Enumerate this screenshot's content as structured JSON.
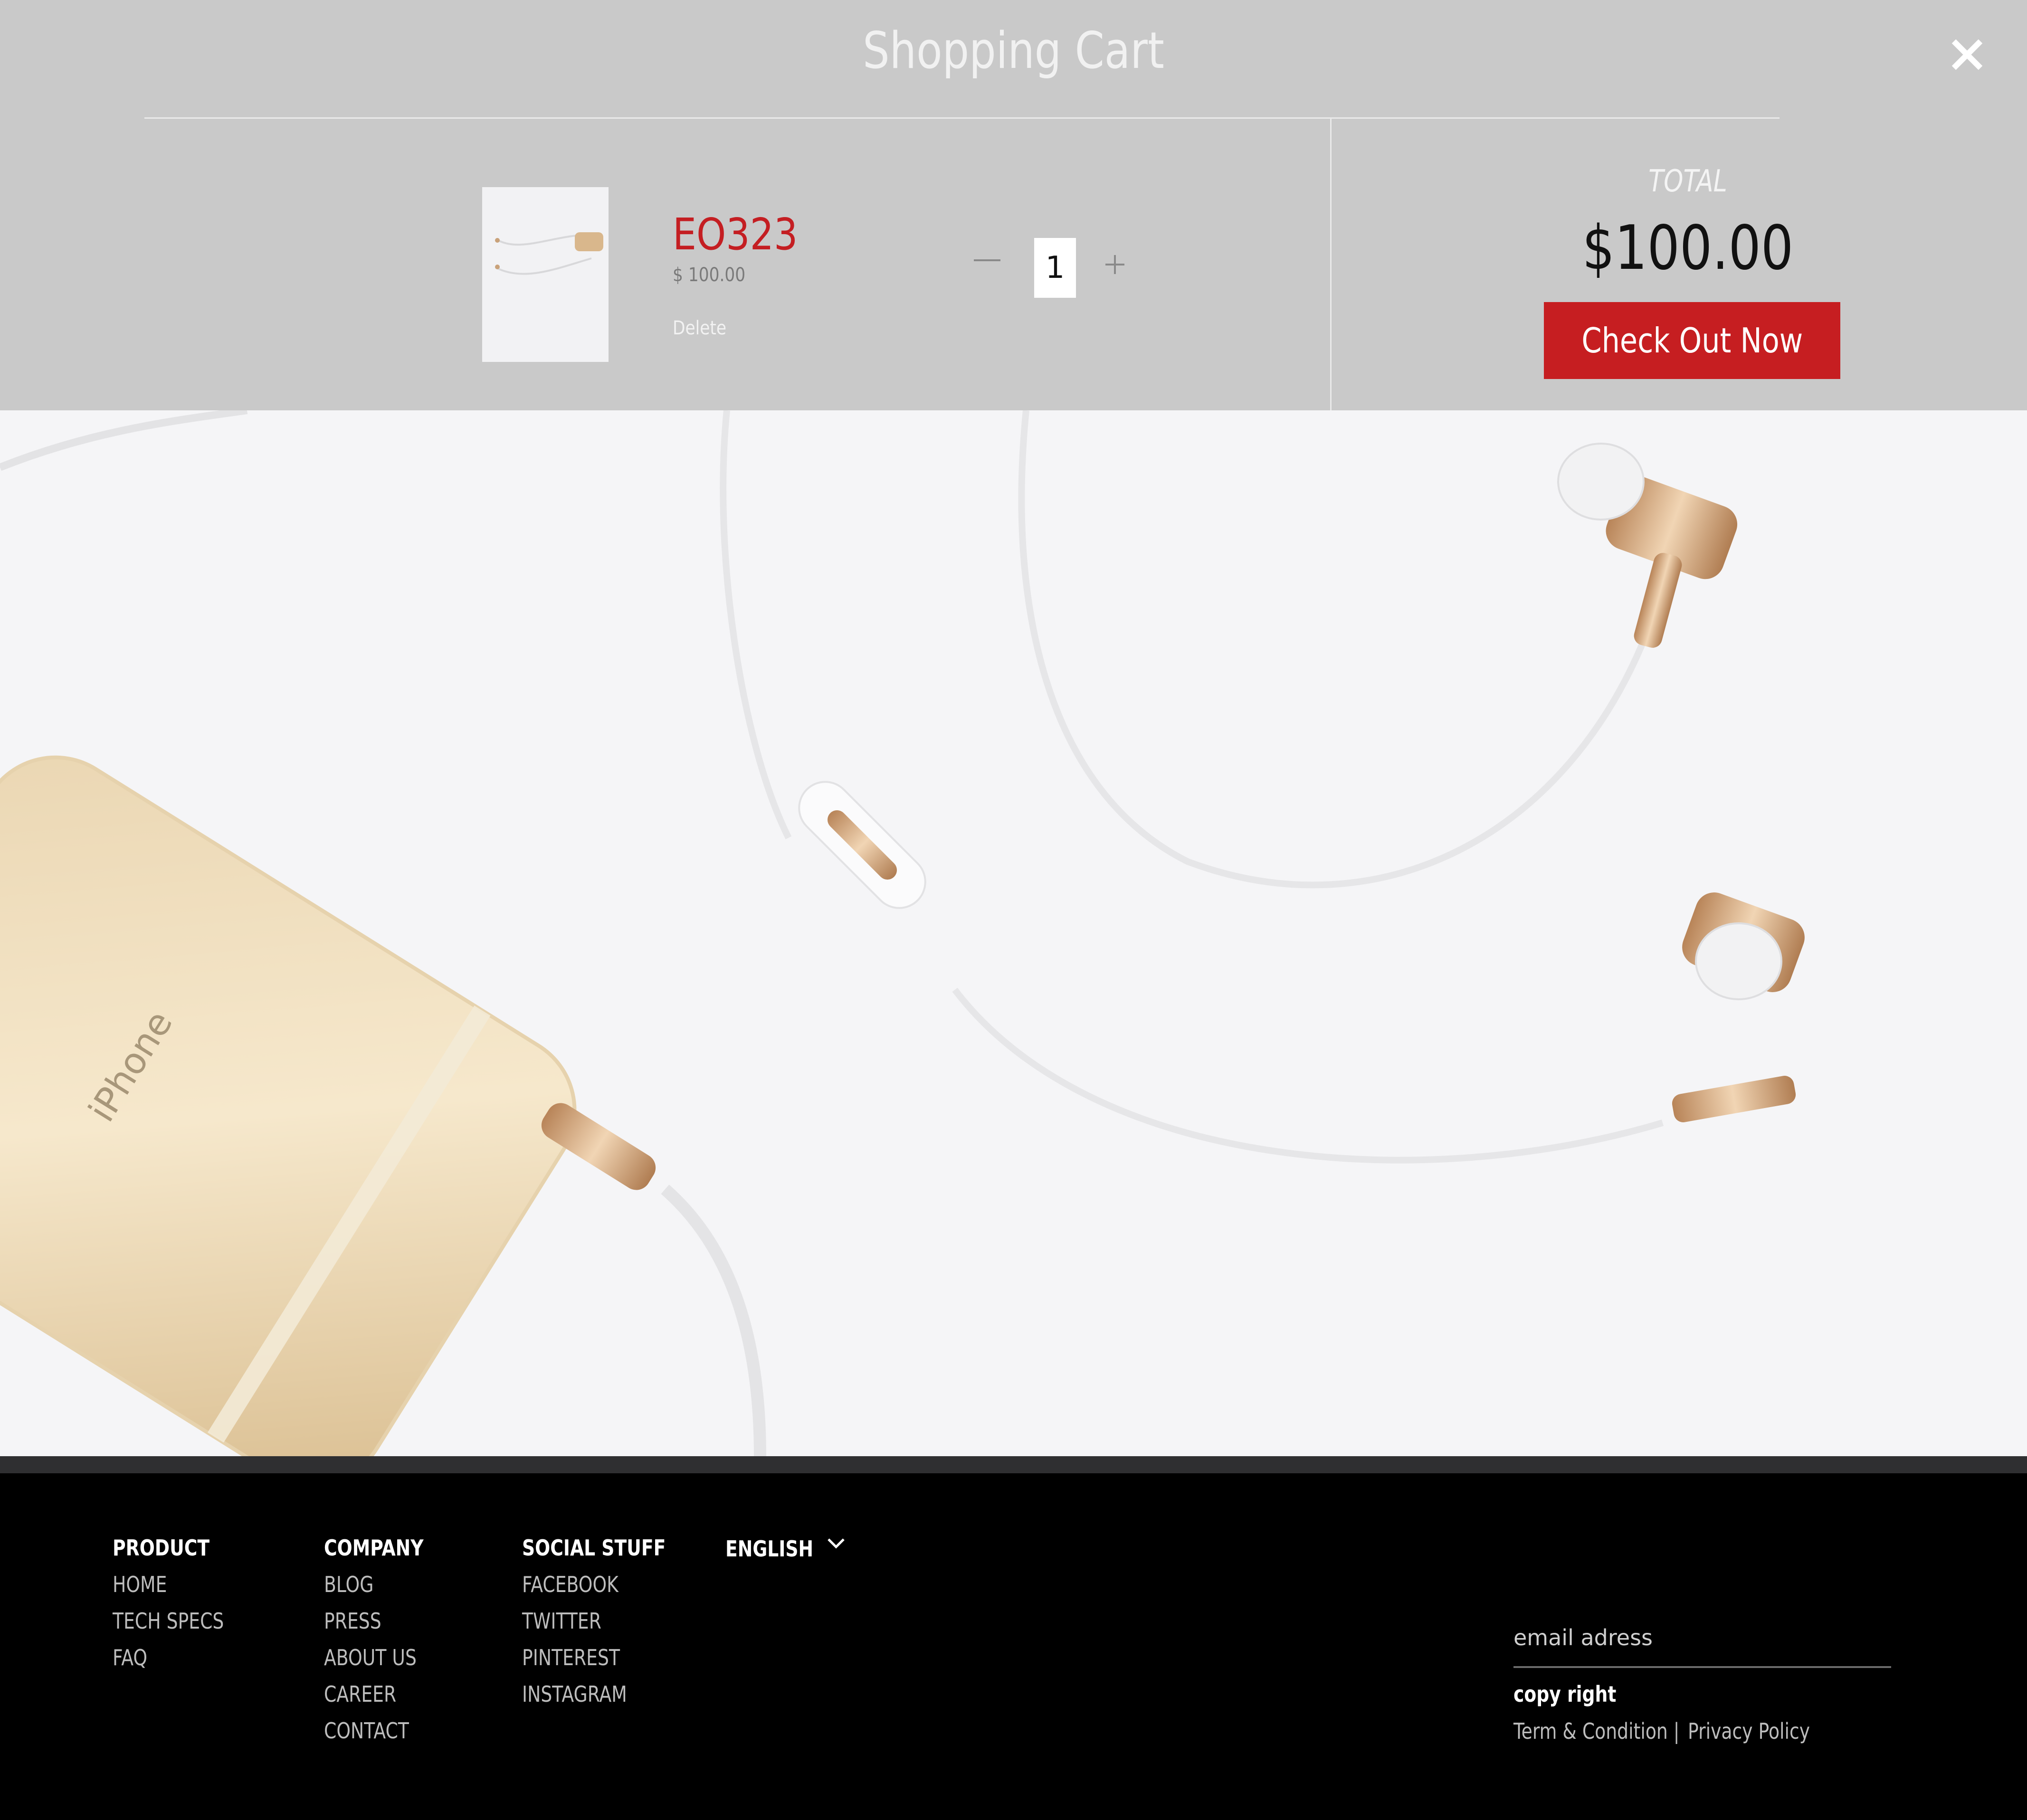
{
  "cart": {
    "title": "Shopping Cart",
    "item": {
      "code": "EO323",
      "price": "$ 100.00",
      "delete_label": "Delete",
      "quantity": "1"
    },
    "total_label": "TOTAL",
    "total_value": "$100.00",
    "checkout_label": "Check Out Now"
  },
  "hero": {
    "phone_text": "iPhone"
  },
  "footer": {
    "product": {
      "heading": "PRODUCT",
      "links": [
        "HOME",
        "TECH SPECS",
        "FAQ"
      ]
    },
    "company": {
      "heading": "COMPANY",
      "links": [
        "BLOG",
        "PRESS",
        "ABOUT US",
        "CAREER",
        "CONTACT"
      ]
    },
    "social": {
      "heading": "SOCIAL STUFF",
      "links": [
        "FACEBOOK",
        "TWITTER",
        "PINTEREST",
        "INSTAGRAM"
      ]
    },
    "language": "ENGLISH",
    "email_placeholder": "email adress",
    "copyright": "copy right",
    "terms": "Term & Condition |",
    "privacy": "Privacy Policy"
  },
  "colors": {
    "accent": "#c61e21",
    "cart_bg": "#c9c9c9",
    "footer_bg": "#000000"
  },
  "icons": {
    "close": "close-icon",
    "minus": "minus-icon",
    "plus": "plus-icon",
    "language_chevron": "chevron-down-icon"
  }
}
